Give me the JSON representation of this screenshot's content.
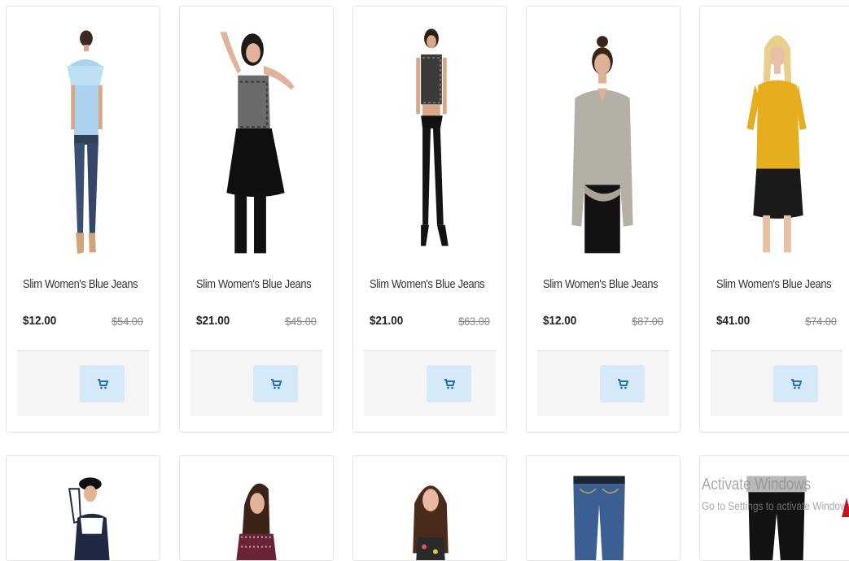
{
  "products_row1": [
    {
      "title": "Slim Women's Blue Jeans",
      "price": "$12.00",
      "old_price": "$54.00",
      "image": "woman-light-blue-ruffle-top-jeans"
    },
    {
      "title": "Slim Women's Blue Jeans",
      "price": "$21.00",
      "old_price": "$45.00",
      "image": "woman-patterned-black-asymmetric-top"
    },
    {
      "title": "Slim Women's Blue Jeans",
      "price": "$21.00",
      "old_price": "$63.00",
      "image": "woman-crop-top-black-pants"
    },
    {
      "title": "Slim Women's Blue Jeans",
      "price": "$12.00",
      "old_price": "$87.00",
      "image": "woman-grey-choker-blouse"
    },
    {
      "title": "Slim Women's Blue Jeans",
      "price": "$41.00",
      "old_price": "$74.00",
      "image": "woman-mustard-blouse-leather-skirt"
    }
  ],
  "products_row2": [
    {
      "image": "woman-hat-navy-white-top"
    },
    {
      "image": "woman-maroon-patterned-top"
    },
    {
      "image": "woman-floral-sleeveless-top"
    },
    {
      "image": "blue-jeans"
    },
    {
      "image": "black-pants"
    }
  ],
  "cart_icon": "cart-icon",
  "colors": {
    "cart_button_bg": "#d6e9f8",
    "cart_icon": "#1f6fb0",
    "footer_bg": "#f5f5f5"
  },
  "watermark": {
    "title": "Activate Windows",
    "subtitle": "Go to Settings to activate Windows."
  }
}
